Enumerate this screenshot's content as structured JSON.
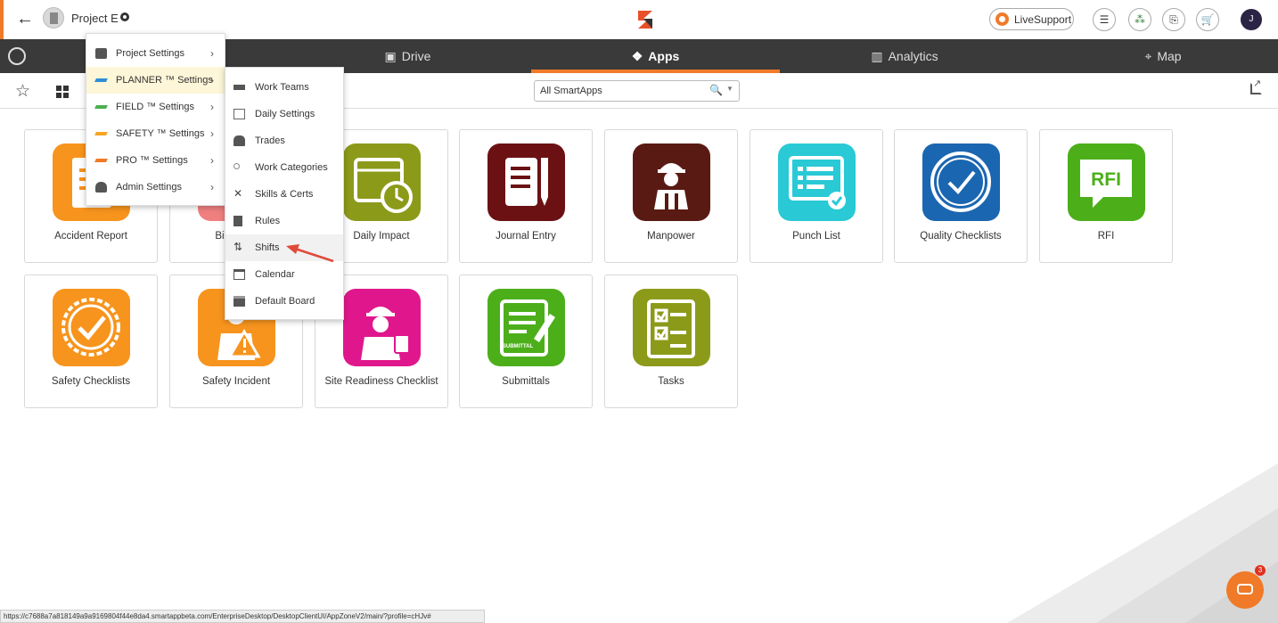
{
  "header": {
    "project_name": "Project E",
    "live_support": "LiveSupport",
    "avatar_initial": "J"
  },
  "nav": {
    "tabs": [
      {
        "label": "Drive",
        "icon": "drive-icon"
      },
      {
        "label": "Apps",
        "icon": "apps-icon",
        "active": true
      },
      {
        "label": "Analytics",
        "icon": "analytics-icon"
      },
      {
        "label": "Map",
        "icon": "map-icon"
      }
    ]
  },
  "toolbar": {
    "search_value": "All SmartApps"
  },
  "settings_menu": {
    "items": [
      {
        "label": "Project Settings",
        "icon": "camera-icon",
        "color": "#555555"
      },
      {
        "label": "PLANNER ™ Settings",
        "icon": "planner-icon",
        "color": "#2e8fd6",
        "highlighted": true
      },
      {
        "label": "FIELD ™ Settings",
        "icon": "field-icon",
        "color": "#4caf50"
      },
      {
        "label": "SAFETY ™ Settings",
        "icon": "safety-icon",
        "color": "#f5a623"
      },
      {
        "label": "PRO ™ Settings",
        "icon": "pro-icon",
        "color": "#f07a28"
      },
      {
        "label": "Admin Settings",
        "icon": "admin-icon",
        "color": "#555555"
      }
    ]
  },
  "planner_submenu": {
    "items": [
      {
        "label": "Work Teams",
        "icon": "team-icon"
      },
      {
        "label": "Daily Settings",
        "icon": "daily-icon"
      },
      {
        "label": "Trades",
        "icon": "worker-icon"
      },
      {
        "label": "Work Categories",
        "icon": "categories-icon"
      },
      {
        "label": "Skills & Certs",
        "icon": "tools-icon"
      },
      {
        "label": "Rules",
        "icon": "rules-icon"
      },
      {
        "label": "Shifts",
        "icon": "shifts-icon",
        "hovered": true
      },
      {
        "label": "Calendar",
        "icon": "calendar-icon"
      },
      {
        "label": "Default Board",
        "icon": "board-icon"
      }
    ]
  },
  "apps": [
    {
      "label": "Accident Report",
      "color": "#f7941d",
      "icon": "accident-report-icon"
    },
    {
      "label": "Bid Invite",
      "color": "#f08080",
      "icon": "bid-invite-icon"
    },
    {
      "label": "Daily Impact",
      "color": "#8c9a1a",
      "icon": "daily-impact-icon"
    },
    {
      "label": "Journal Entry",
      "color": "#6b1114",
      "icon": "journal-icon"
    },
    {
      "label": "Manpower",
      "color": "#5a1a14",
      "icon": "manpower-icon"
    },
    {
      "label": "Punch List",
      "color": "#29c9d6",
      "icon": "punch-list-icon"
    },
    {
      "label": "Quality Checklists",
      "color": "#1b66b1",
      "icon": "quality-icon"
    },
    {
      "label": "RFI",
      "color": "#4caf1a",
      "icon": "rfi-icon",
      "text": "RFI"
    },
    {
      "label": "Safety Checklists",
      "color": "#f7941d",
      "icon": "safety-checklist-icon"
    },
    {
      "label": "Safety Incident",
      "color": "#f7941d",
      "icon": "safety-incident-icon"
    },
    {
      "label": "Site Readiness Checklist",
      "color": "#e0178c",
      "icon": "site-readiness-icon"
    },
    {
      "label": "Submittals",
      "color": "#4caf1a",
      "icon": "submittal-icon",
      "text": "SUBMITTAL"
    },
    {
      "label": "Tasks",
      "color": "#8c9a1a",
      "icon": "tasks-icon"
    }
  ],
  "status_url": "https://c7688a7a818149a9a9169804f44e8da4.smartappbeta.com/EnterpriseDesktop/DesktopClientUI/AppZoneV2/main/?profile=cHJv#",
  "chat_badge": "3"
}
